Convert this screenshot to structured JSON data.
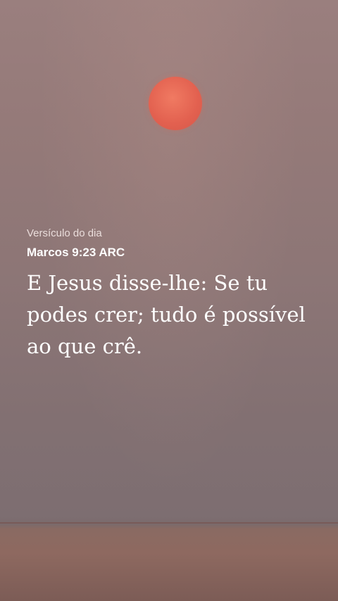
{
  "verse_card": {
    "eyebrow": "Versículo do dia",
    "reference": "Marcos 9:23 ARC",
    "text": "E Jesus disse-lhe: Se tu podes crer; tudo é possível ao que crê."
  },
  "colors": {
    "sky": "#957a79",
    "sun": "#e2604f",
    "ground": "#8e6960",
    "text": "#ffffff"
  }
}
